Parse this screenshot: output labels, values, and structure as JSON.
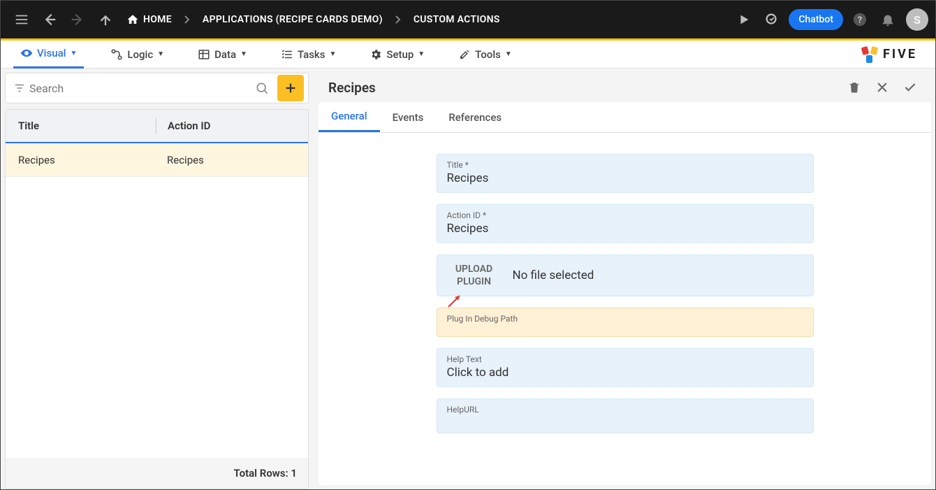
{
  "top": {
    "breadcrumbs": {
      "home": "HOME",
      "app": "APPLICATIONS (RECIPE CARDS DEMO)",
      "page": "CUSTOM ACTIONS"
    },
    "chatbot": "Chatbot",
    "avatar": "S"
  },
  "mainTabs": {
    "visual": "Visual",
    "logic": "Logic",
    "data": "Data",
    "tasks": "Tasks",
    "setup": "Setup",
    "tools": "Tools"
  },
  "logo": "FIVE",
  "left": {
    "searchPlaceholder": "Search",
    "cols": {
      "title": "Title",
      "actionId": "Action ID"
    },
    "rows": [
      {
        "title": "Recipes",
        "actionId": "Recipes"
      }
    ],
    "footerLabel": "Total Rows:",
    "footerCount": "1"
  },
  "right": {
    "title": "Recipes",
    "tabs": {
      "general": "General",
      "events": "Events",
      "references": "References"
    },
    "fields": {
      "titleLabel": "Title *",
      "titleVal": "Recipes",
      "actionIdLabel": "Action ID *",
      "actionIdVal": "Recipes",
      "uploadBtn": "UPLOAD PLUGIN",
      "uploadStatus": "No file selected",
      "debugLabel": "Plug In Debug Path",
      "helpLabel": "Help Text",
      "helpVal": "Click to add",
      "helpUrlLabel": "HelpURL"
    }
  }
}
